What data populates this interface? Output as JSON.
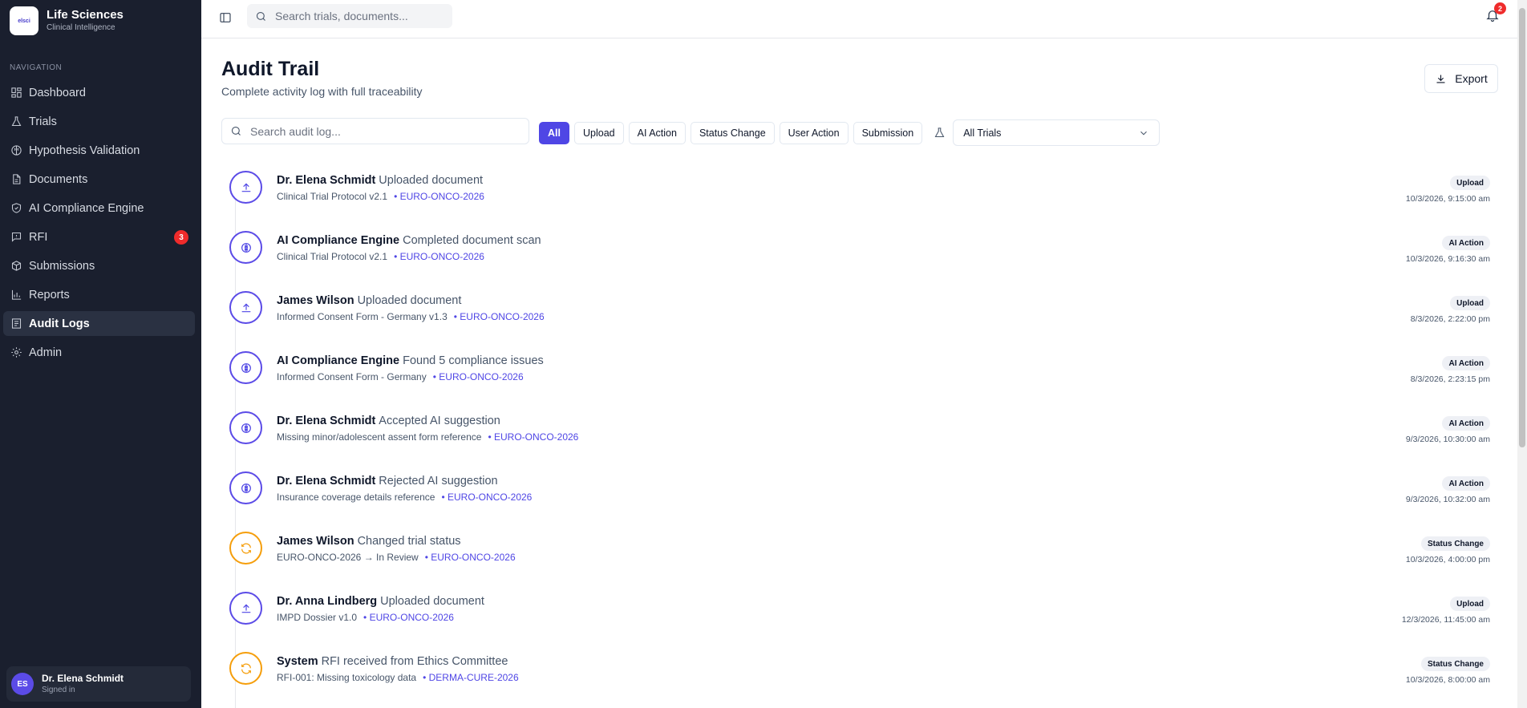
{
  "brand": {
    "logo_text": "elsci",
    "title": "Life Sciences",
    "subtitle": "Clinical Intelligence"
  },
  "sidebar": {
    "heading": "NAVIGATION",
    "items": [
      {
        "label": "Dashboard",
        "icon": "dashboard-icon"
      },
      {
        "label": "Trials",
        "icon": "flask-icon"
      },
      {
        "label": "Hypothesis Validation",
        "icon": "brain-icon"
      },
      {
        "label": "Documents",
        "icon": "document-icon"
      },
      {
        "label": "AI Compliance Engine",
        "icon": "shield-icon"
      },
      {
        "label": "RFI",
        "icon": "message-icon",
        "badge": "3"
      },
      {
        "label": "Submissions",
        "icon": "package-icon"
      },
      {
        "label": "Reports",
        "icon": "bar-chart-icon"
      },
      {
        "label": "Audit Logs",
        "icon": "log-icon",
        "active": true
      },
      {
        "label": "Admin",
        "icon": "gear-icon"
      }
    ]
  },
  "user": {
    "initials": "ES",
    "name": "Dr. Elena Schmidt",
    "status": "Signed in"
  },
  "topbar": {
    "search_placeholder": "Search trials, documents...",
    "notification_count": "2"
  },
  "page": {
    "title": "Audit Trail",
    "subtitle": "Complete activity log with full traceability",
    "export_label": "Export",
    "search_placeholder": "Search audit log...",
    "filters": [
      "All",
      "Upload",
      "AI Action",
      "Status Change",
      "User Action",
      "Submission"
    ],
    "active_filter": "All",
    "trial_select": "All Trials"
  },
  "entries": [
    {
      "actor": "Dr. Elena Schmidt",
      "action": "Uploaded document",
      "detail": "Clinical Trial Protocol v2.1",
      "trial": "• EURO-ONCO-2026",
      "badge": "Upload",
      "time": "10/3/2026, 9:15:00 am",
      "icon": "upload-icon",
      "color": "#5b4be7"
    },
    {
      "actor": "AI Compliance Engine",
      "action": "Completed document scan",
      "detail": "Clinical Trial Protocol v2.1",
      "trial": "• EURO-ONCO-2026",
      "badge": "AI Action",
      "time": "10/3/2026, 9:16:30 am",
      "icon": "brain-icon",
      "color": "#5b4be7"
    },
    {
      "actor": "James Wilson",
      "action": "Uploaded document",
      "detail": "Informed Consent Form - Germany v1.3",
      "trial": "• EURO-ONCO-2026",
      "badge": "Upload",
      "time": "8/3/2026, 2:22:00 pm",
      "icon": "upload-icon",
      "color": "#5b4be7"
    },
    {
      "actor": "AI Compliance Engine",
      "action": "Found 5 compliance issues",
      "detail": "Informed Consent Form - Germany",
      "trial": "• EURO-ONCO-2026",
      "badge": "AI Action",
      "time": "8/3/2026, 2:23:15 pm",
      "icon": "brain-icon",
      "color": "#5b4be7"
    },
    {
      "actor": "Dr. Elena Schmidt",
      "action": "Accepted AI suggestion",
      "detail": "Missing minor/adolescent assent form reference",
      "trial": "• EURO-ONCO-2026",
      "badge": "AI Action",
      "time": "9/3/2026, 10:30:00 am",
      "icon": "brain-icon",
      "color": "#5b4be7"
    },
    {
      "actor": "Dr. Elena Schmidt",
      "action": "Rejected AI suggestion",
      "detail": "Insurance coverage details reference",
      "trial": "• EURO-ONCO-2026",
      "badge": "AI Action",
      "time": "9/3/2026, 10:32:00 am",
      "icon": "brain-icon",
      "color": "#5b4be7"
    },
    {
      "actor": "James Wilson",
      "action": "Changed trial status",
      "detail": "EURO-ONCO-2026 → In Review",
      "trial": "• EURO-ONCO-2026",
      "badge": "Status Change",
      "time": "10/3/2026, 4:00:00 pm",
      "icon": "refresh-icon",
      "color": "#f59e0b"
    },
    {
      "actor": "Dr. Anna Lindberg",
      "action": "Uploaded document",
      "detail": "IMPD Dossier v1.0",
      "trial": "• EURO-ONCO-2026",
      "badge": "Upload",
      "time": "12/3/2026, 11:45:00 am",
      "icon": "upload-icon",
      "color": "#5b4be7"
    },
    {
      "actor": "System",
      "action": "RFI received from Ethics Committee",
      "detail": "RFI-001: Missing toxicology data",
      "trial": "• DERMA-CURE-2026",
      "badge": "Status Change",
      "time": "10/3/2026, 8:00:00 am",
      "icon": "refresh-icon",
      "color": "#f59e0b"
    }
  ]
}
